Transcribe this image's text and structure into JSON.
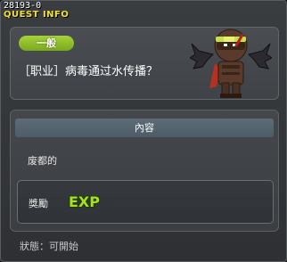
{
  "window": {
    "quest_id": "28193-0",
    "title": "QUEST INFO"
  },
  "quest": {
    "category": "一般",
    "title": "［职业］病毒通过水传播？"
  },
  "content": {
    "header": "內容",
    "text": "废都的"
  },
  "reward": {
    "label": "獎勵",
    "exp_icon_text": "EXP"
  },
  "status": {
    "label": "狀態：",
    "value": "可開始"
  },
  "icons": {
    "character": "ninja-character-icon",
    "exp": "exp-icon"
  },
  "colors": {
    "title_yellow": "#f0e030",
    "badge_green": "#8cbc28",
    "exp_green": "#a8e020"
  }
}
